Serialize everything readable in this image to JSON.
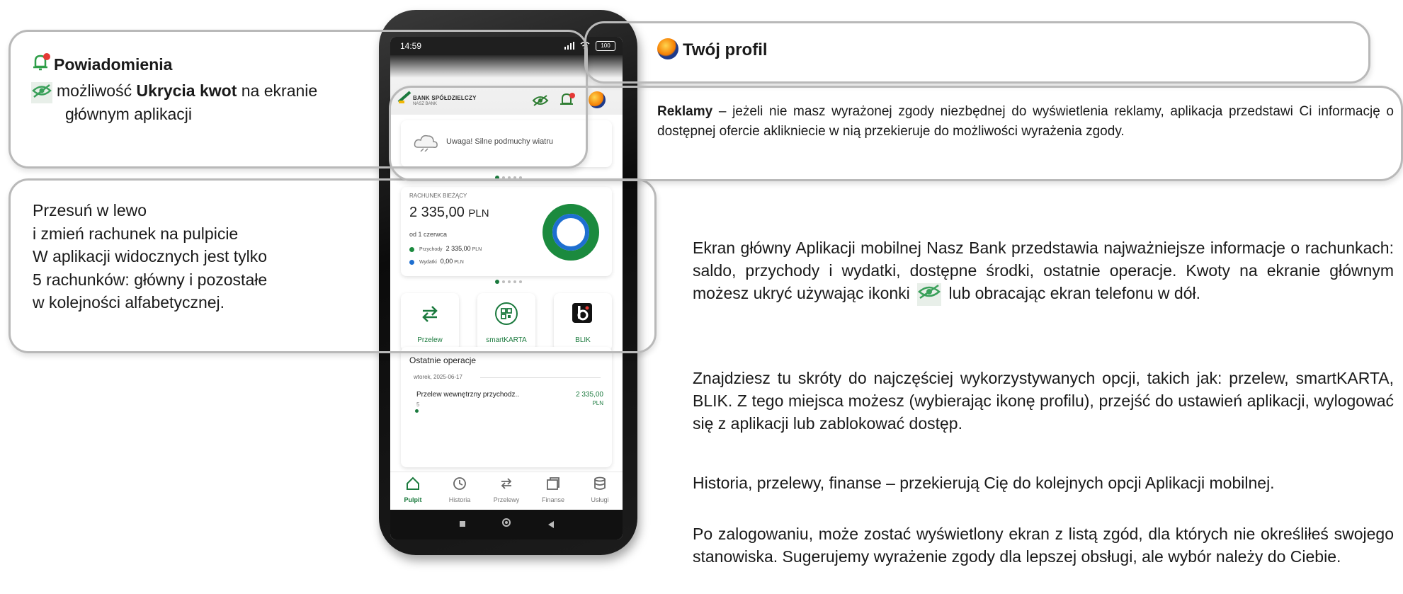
{
  "callouts": {
    "notifications": {
      "title": "Powiadomienia",
      "prefix": "możliwość ",
      "bold": "Ukrycia kwot",
      "suffix": " na ekranie",
      "line2": "głównym aplikacji"
    },
    "swipe": {
      "lines": [
        "Przesuń w lewo",
        "i zmień rachunek na pulpicie",
        "W aplikacji widocznych jest tylko",
        "5 rachunków: główny i pozostałe",
        "w kolejności alfabetycznej."
      ]
    },
    "profile": {
      "title": "Twój profil"
    },
    "ads": {
      "bold": "Reklamy",
      "text": " – jeżeli nie masz wyrażonej zgody niezbędnej do wyświetlenia reklamy, aplikacja przedstawi Ci informację o dostępnej ofercie aklikniecie w nią przekieruje do możliwości wyrażenia zgody."
    }
  },
  "phone": {
    "status": {
      "time": "14:59",
      "battery": "100"
    },
    "header": {
      "bank_name": "BANK SPÓŁDZIELCZY",
      "bank_sub": "NASZ BANK"
    },
    "ad_card": {
      "text": "Uwaga! Silne podmuchy wiatru"
    },
    "account": {
      "label": "RACHUNEK BIEŻĄCY",
      "balance": "2 335,00",
      "currency": "PLN",
      "since": "od 1 czerwca",
      "income_label": "Przychody",
      "income_value": "2 335,00",
      "income_currency": "PLN",
      "expense_label": "Wydatki",
      "expense_value": "0,00",
      "expense_currency": "PLN",
      "income_share": 1.0,
      "colors": {
        "income": "#1b8a3e",
        "expense": "#1e6fd0"
      }
    },
    "shortcuts": [
      {
        "label": "Przelew"
      },
      {
        "label": "smartKARTA"
      },
      {
        "label": "BLIK"
      }
    ],
    "recent": {
      "title": "Ostatnie operacje",
      "date": "wtorek, 2025-06-17",
      "op_title": "Przelew wewnętrzny przychodz..",
      "op_sub": "5",
      "op_amount": "2 335,00",
      "op_currency": "PLN"
    },
    "nav": [
      {
        "label": "Pulpit",
        "icon": "home-icon"
      },
      {
        "label": "Historia",
        "icon": "history-icon"
      },
      {
        "label": "Przelewy",
        "icon": "transfers-icon"
      },
      {
        "label": "Finanse",
        "icon": "finance-icon"
      },
      {
        "label": "Usługi",
        "icon": "services-icon"
      }
    ]
  },
  "description": {
    "p1_before": "Ekran główny Aplikacji mobilnej Nasz Bank przedstawia najważniejsze informacje o rachunkach: saldo, przychody i wydatki, dostępne środki, ostatnie operacje. Kwoty na ekranie głównym możesz ukryć używając ikonki ",
    "p1_after": " lub obracając ekran telefonu w dół.",
    "p2": "Znajdziesz tu skróty do najczęściej wykorzystywanych opcji, takich jak: przelew, smartKARTA, BLIK. Z tego miejsca możesz (wybierając ikonę profilu), przejść do ustawień aplikacji, wylogować się z aplikacji lub zablokować dostęp.",
    "p3": "Historia, przelewy, finanse – przekierują Cię do kolejnych opcji Aplikacji mobilnej.",
    "p4": "Po zalogowaniu, może zostać wyświetlony ekran z listą zgód, dla których nie określiłeś swojego stanowiska.  Sugerujemy wyrażenie zgody dla lepszej obsługi, ale wybór należy do Ciebie."
  }
}
